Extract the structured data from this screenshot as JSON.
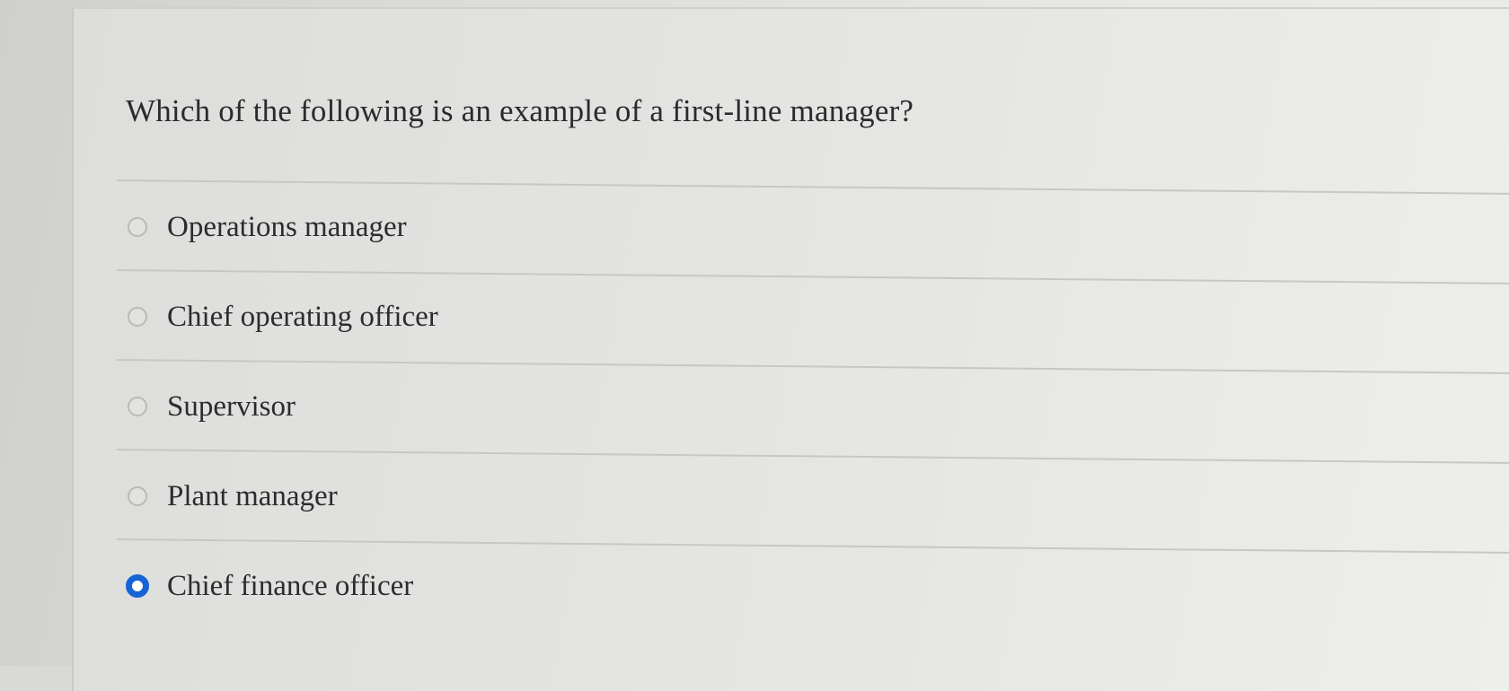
{
  "question": {
    "text": "Which of the following is an example of a first-line manager?"
  },
  "options": [
    {
      "label": "Operations manager",
      "selected": false
    },
    {
      "label": "Chief operating officer",
      "selected": false
    },
    {
      "label": "Supervisor",
      "selected": false
    },
    {
      "label": "Plant manager",
      "selected": false
    },
    {
      "label": "Chief finance officer",
      "selected": true
    }
  ],
  "colors": {
    "selected_radio": "#1663d6"
  }
}
